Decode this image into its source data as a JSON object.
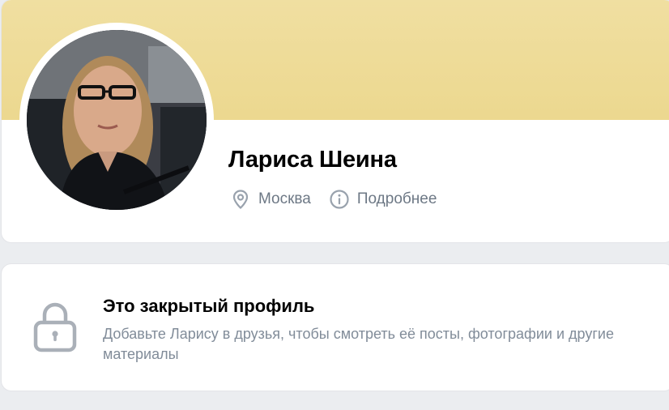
{
  "profile": {
    "name": "Лариса Шеина",
    "city": "Москва",
    "details_link": "Подробнее",
    "cover_color": "#eedb96"
  },
  "icons": {
    "location": "location-pin-icon",
    "info": "info-circle-icon",
    "lock": "lock-icon"
  },
  "closed_profile": {
    "title": "Это закрытый профиль",
    "description": "Добавьте Ларису в друзья, чтобы смотреть её посты, фотографии и другие материалы"
  },
  "colors": {
    "background": "#ebedf0",
    "secondary_text": "#818c99",
    "icon_gray": "#99a2ad"
  }
}
